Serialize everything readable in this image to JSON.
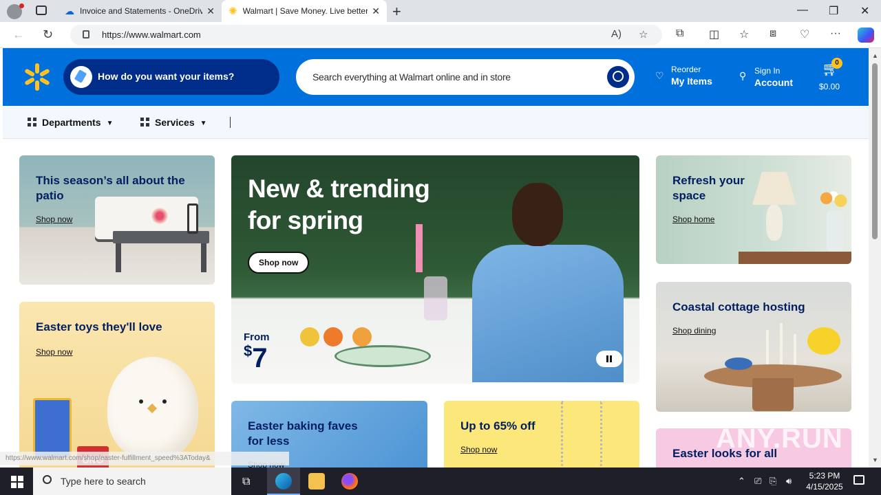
{
  "browser": {
    "tabs": [
      {
        "title": "Invoice and Statements - OneDrive",
        "active": false
      },
      {
        "title": "Walmart | Save Money. Live better.",
        "active": true
      }
    ],
    "url": "https://www.walmart.com"
  },
  "header": {
    "fulfillment_label": "How do you want your items?",
    "search_placeholder": "Search everything at Walmart online and in store",
    "reorder_small": "Reorder",
    "reorder_big": "My Items",
    "signin_small": "Sign In",
    "signin_big": "Account",
    "cart_count": "0",
    "cart_total": "$0.00"
  },
  "subnav": {
    "departments": "Departments",
    "services": "Services"
  },
  "cards": {
    "patio": {
      "title": "This season’s all about the patio",
      "link": "Shop now"
    },
    "easter_toys": {
      "title": "Easter toys they'll love",
      "link": "Shop now"
    },
    "hero": {
      "title_line1": "New & trending",
      "title_line2": "for spring",
      "button": "Shop now",
      "from": "From",
      "price_symbol": "$",
      "price": "7"
    },
    "baking": {
      "title": "Easter baking faves for less",
      "link": "Shop now"
    },
    "sale": {
      "title": "Up to 65% off",
      "link": "Shop now"
    },
    "refresh": {
      "title": "Refresh your space",
      "link": "Shop home"
    },
    "coastal": {
      "title": "Coastal cottage hosting",
      "link": "Shop dining"
    },
    "looks": {
      "title": "Easter looks for all"
    }
  },
  "toy_label": "UNO",
  "status_bar_url": "https://www.walmart.com/shop/easter-fulfillment_speed%3AToday&",
  "watermark": "ANY.RUN",
  "taskbar": {
    "search_placeholder": "Type here to search",
    "time": "5:23 PM",
    "date": "4/15/2025"
  },
  "colors": {
    "walmart_blue": "#0071dc",
    "walmart_navy": "#002d8a",
    "spark_yellow": "#ffc220"
  }
}
